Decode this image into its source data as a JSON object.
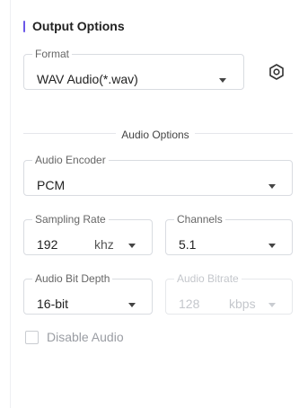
{
  "section": {
    "title": "Output Options"
  },
  "format": {
    "legend": "Format",
    "value": "WAV Audio(*.wav)"
  },
  "audio_options": {
    "label": "Audio Options"
  },
  "encoder": {
    "legend": "Audio Encoder",
    "value": "PCM"
  },
  "sampling_rate": {
    "legend": "Sampling Rate",
    "value": "192",
    "unit": "khz"
  },
  "channels": {
    "legend": "Channels",
    "value": "5.1"
  },
  "bit_depth": {
    "legend": "Audio Bit Depth",
    "value": "16-bit"
  },
  "bitrate": {
    "legend": "Audio Bitrate",
    "value": "128",
    "unit": "kbps",
    "disabled": true
  },
  "disable_audio": {
    "label": "Disable Audio",
    "checked": false
  },
  "icons": {
    "settings": "settings-hexagon-icon",
    "dropdown": "chevron-down-icon"
  },
  "colors": {
    "accent": "#6a57e8"
  }
}
